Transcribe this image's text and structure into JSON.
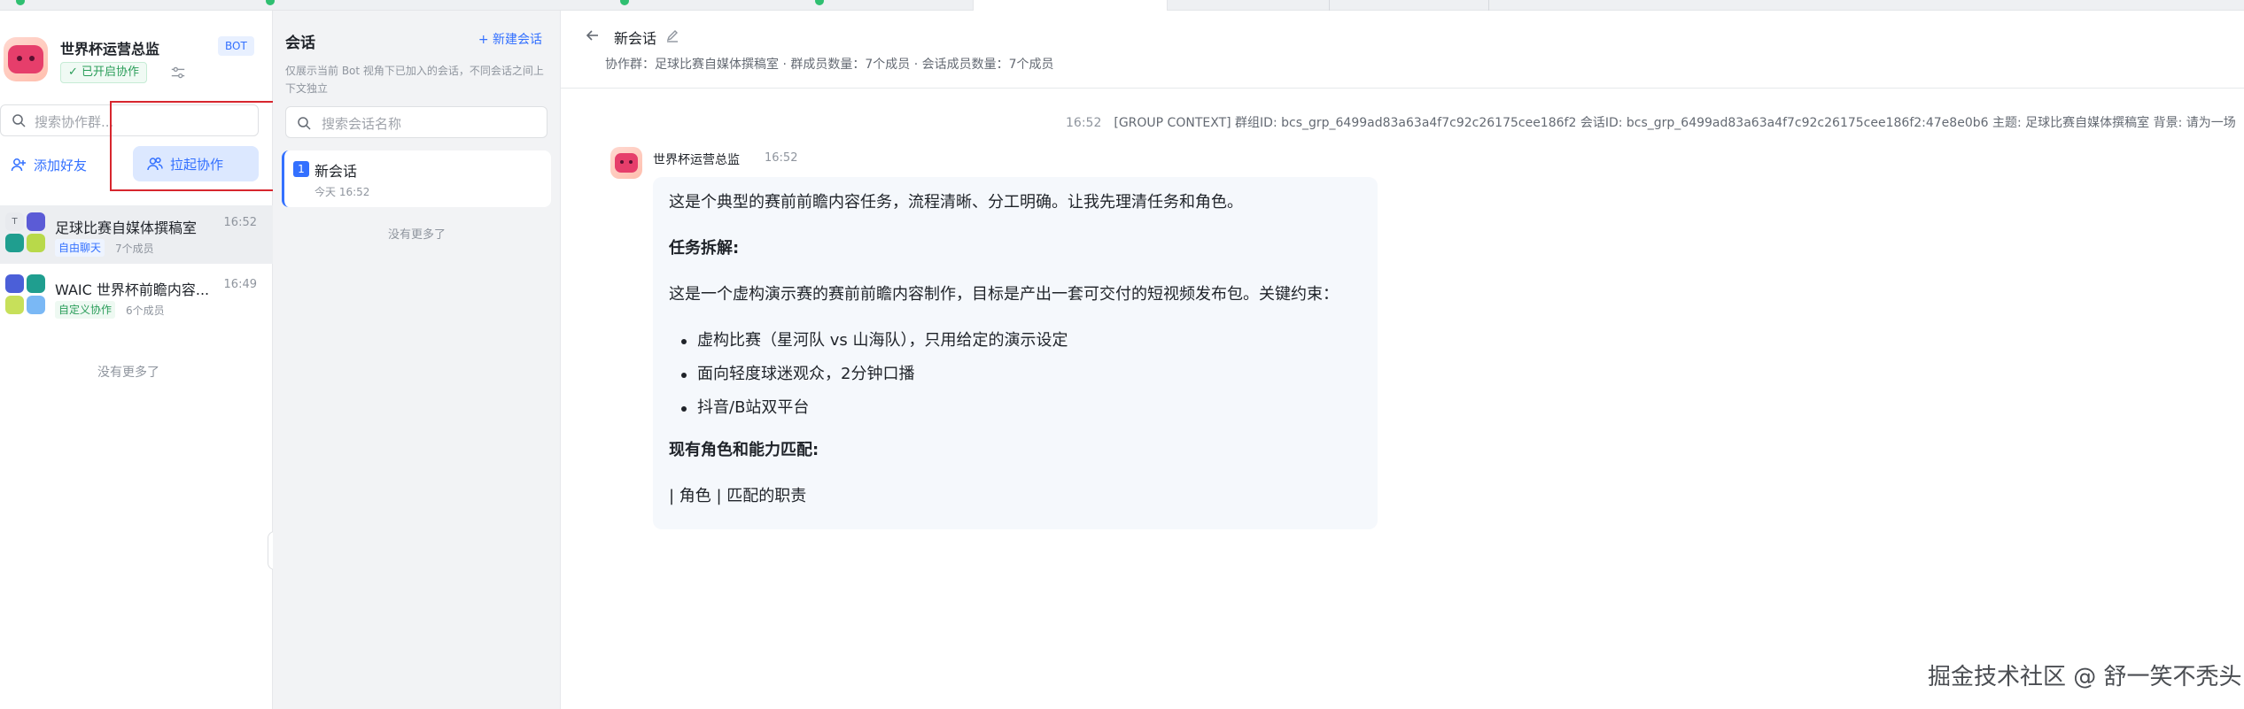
{
  "bot": {
    "name": "世界杯运营总监",
    "badge": "BOT",
    "collab_status": "已开启协作"
  },
  "left_panel": {
    "search_placeholder": "搜索协作群...",
    "add_friend_label": "添加好友",
    "pull_collab_label": "拉起协作",
    "groups": [
      {
        "name": "足球比赛自媒体撰稿室",
        "time": "16:52",
        "tag": "自由聊天",
        "members": "7个成员",
        "tag_color": "#3370ff"
      },
      {
        "name": "WAIC 世界杯前瞻内容...",
        "time": "16:49",
        "tag": "自定义协作",
        "members": "6个成员",
        "tag_color": "#2a9d59"
      }
    ],
    "no_more": "没有更多了"
  },
  "sessions_panel": {
    "title": "会话",
    "new_session_label": "+ 新建会话",
    "description": "仅展示当前 Bot 视角下已加入的会话，不同会话之间上下文独立",
    "search_placeholder": "搜索会话名称",
    "items": [
      {
        "index": "1",
        "name": "新会话",
        "time": "今天 16:52"
      }
    ],
    "no_more": "没有更多了"
  },
  "chat": {
    "title": "新会话",
    "meta": "协作群：足球比赛自媒体撰稿室 · 群成员数量：7个成员 · 会话成员数量：7个成员",
    "context_time": "16:52",
    "context_text": "[GROUP CONTEXT] 群组ID: bcs_grp_6499ad83a63a4f7c92c26175cee186f2 会话ID: bcs_grp_6499ad83a63a4f7c92c26175cee186f2:47e8e0b6 主题: 足球比赛自媒体撰稿室 背景: 请为一场",
    "message": {
      "sender": "世界杯运营总监",
      "time": "16:52",
      "intro": "这是个典型的赛前前瞻内容任务，流程清晰、分工明确。让我先理清任务和角色。",
      "section1": "任务拆解:",
      "body": "这是一个虚构演示赛的赛前前瞻内容制作，目标是产出一套可交付的短视频发布包。关键约束：",
      "bullets": [
        "虚构比赛（星河队 vs 山海队），只用给定的演示设定",
        "面向轻度球迷观众，2分钟口播",
        "抖音/B站双平台"
      ],
      "section2": "现有角色和能力匹配:",
      "table_line": "| 角色 | 匹配的职责"
    }
  },
  "watermark": "掘金技术社区 @ 舒一笑不秃头",
  "colors": {
    "accent": "#3370ff",
    "success": "#2a9d59",
    "highlight_box": "#d7262e",
    "bot_avatar": "#e63e6b"
  },
  "icons": [
    "search-icon",
    "settings-icon",
    "add-user-icon",
    "users-icon",
    "back-arrow-icon",
    "edit-icon",
    "chevron-left-icon"
  ]
}
